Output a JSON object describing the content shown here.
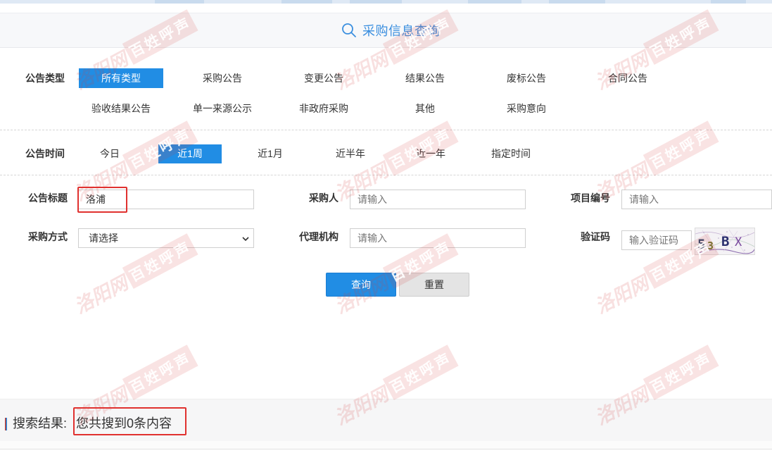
{
  "header": {
    "title": "采购信息查询",
    "icon": "search-icon"
  },
  "filters": {
    "notice_type": {
      "label": "公告类型",
      "selected": "所有类型",
      "options": [
        "所有类型",
        "采购公告",
        "变更公告",
        "结果公告",
        "废标公告",
        "合同公告",
        "验收结果公告",
        "单一来源公示",
        "非政府采购",
        "其他",
        "采购意向"
      ]
    },
    "notice_time": {
      "label": "公告时间",
      "selected": "近1周",
      "options": [
        "今日",
        "近1周",
        "近1月",
        "近半年",
        "近一年",
        "指定时间"
      ]
    }
  },
  "form": {
    "title": {
      "label": "公告标题",
      "value": "洛浦"
    },
    "purchaser": {
      "label": "采购人",
      "placeholder": "请输入"
    },
    "project_no": {
      "label": "项目编号",
      "placeholder": "请输入"
    },
    "method": {
      "label": "采购方式",
      "selected": "请选择",
      "icon": "chevron-down-icon"
    },
    "agency": {
      "label": "代理机构",
      "placeholder": "请输入"
    },
    "captcha": {
      "label": "验证码",
      "placeholder": "输入验证码",
      "chars": [
        "5",
        "3",
        "B",
        "X"
      ]
    }
  },
  "buttons": {
    "query": "查询",
    "reset": "重置"
  },
  "results": {
    "label": "搜索结果:",
    "summary": "您共搜到0条内容"
  },
  "watermark": {
    "site": "洛阳网",
    "slogan": "百姓呼声"
  },
  "colors": {
    "accent": "#218de4",
    "header_text": "#3b8fdf",
    "annotation": "#e0312f",
    "reset_button": "#e4e4e4"
  }
}
